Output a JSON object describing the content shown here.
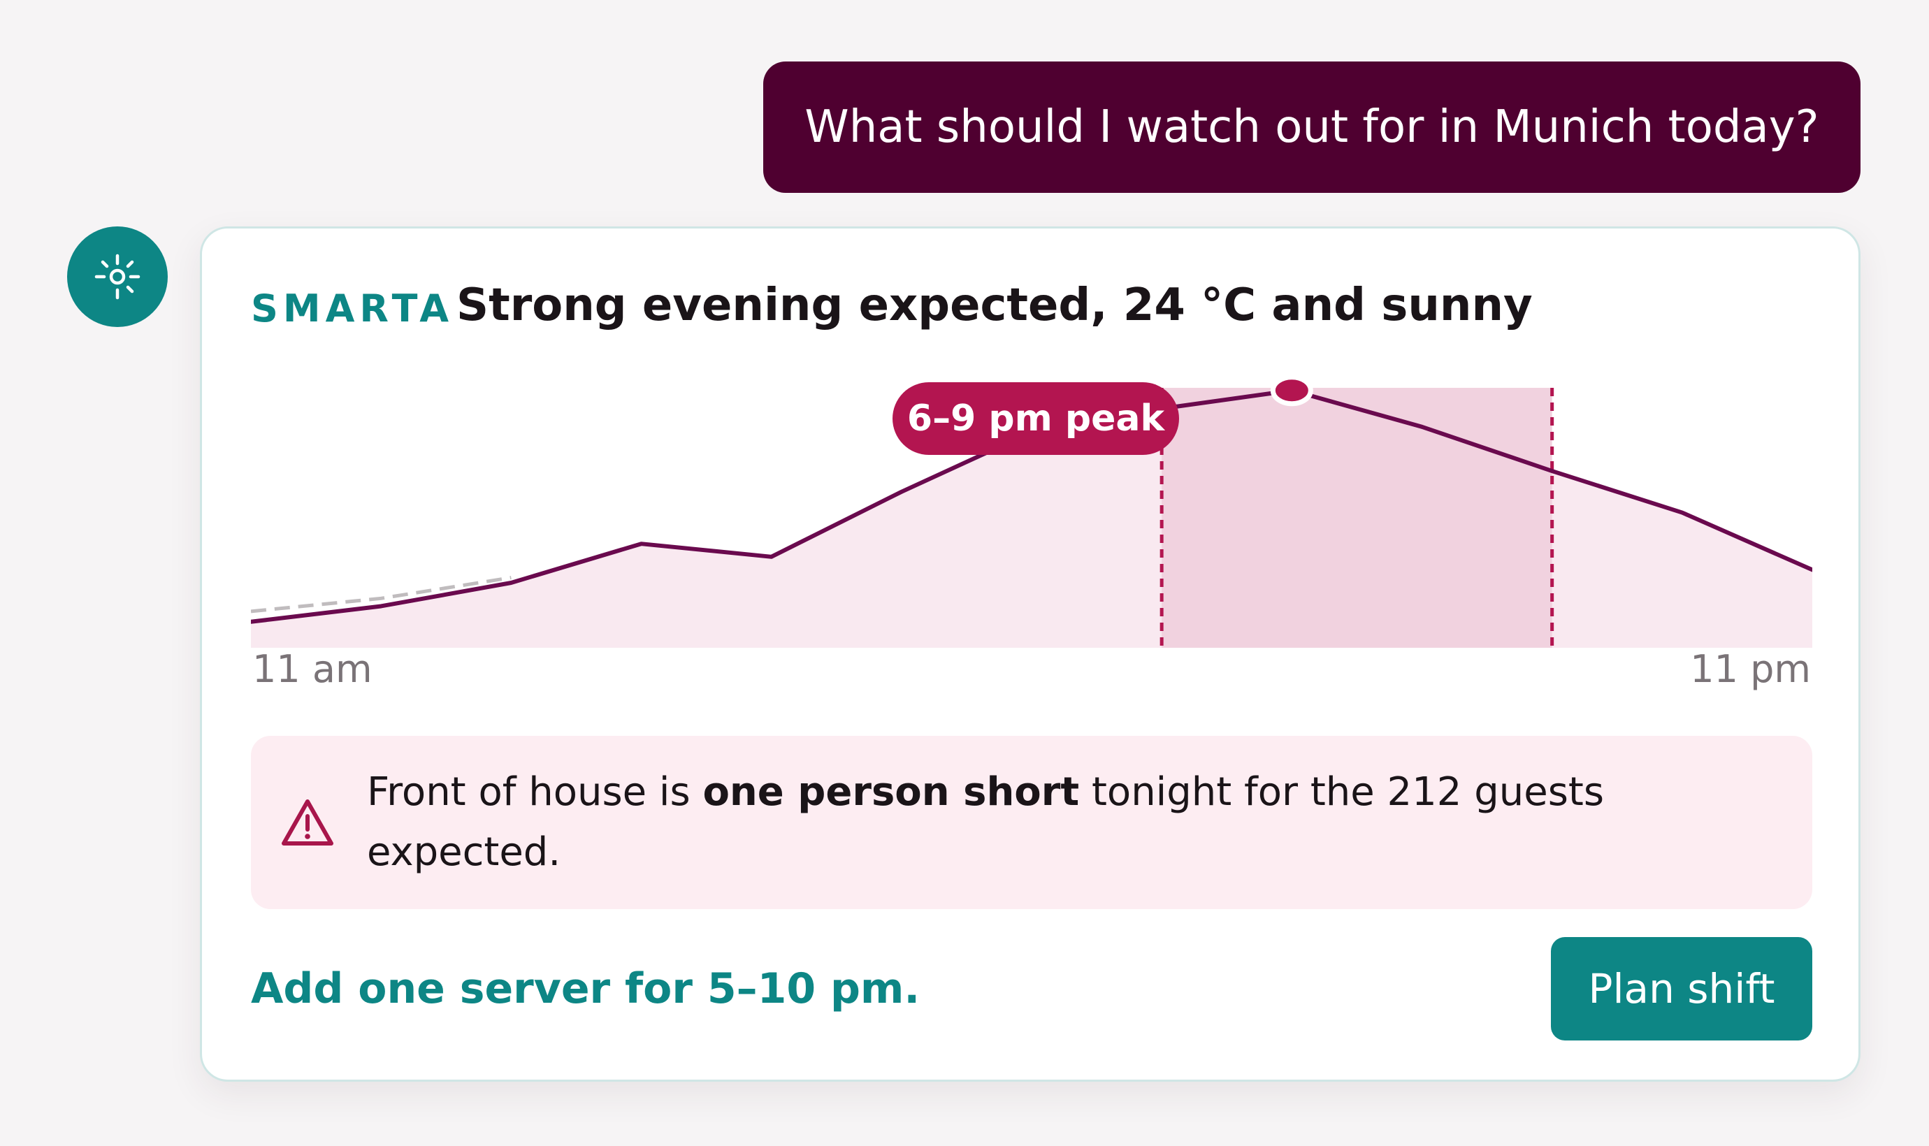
{
  "conversation": {
    "user_message": "What should I watch out for in Munich today?",
    "assistant_icon": "sun-icon"
  },
  "card": {
    "brand": "SMARTA",
    "headline": "Strong evening expected, 24 °C and sunny",
    "peak_label": "6–9 pm peak",
    "alert": {
      "icon": "warning-triangle-icon",
      "text_before": "Front of house is ",
      "text_bold": "one person short",
      "text_after": " tonight for the 212 guests expected."
    },
    "recommendation": "Add one server for 5–10 pm.",
    "plan_button_label": "Plan shift"
  },
  "colors": {
    "brand_teal": "#0d8685",
    "user_bubble": "#4f0030",
    "line": "#6a0a4e",
    "peak_accent": "#b31550",
    "area_fill": "#f9e9f0",
    "peak_band": "#f1d2df",
    "alert_bg": "#fdedf2",
    "baseline": "#c0bcbe"
  },
  "chart_data": {
    "type": "line",
    "x_start_label": "11 am",
    "x_end_label": "11 pm",
    "x_hours": [
      11,
      12,
      13,
      14,
      15,
      16,
      17,
      18,
      19,
      20,
      21,
      22,
      23
    ],
    "series": [
      {
        "values": [
          10,
          16,
          25,
          40,
          35,
          60,
          83,
          92,
          99,
          85,
          68,
          52,
          30
        ]
      }
    ],
    "baseline_values": [
      14,
      19,
      27
    ],
    "peak_window": [
      18,
      21
    ],
    "peak_point_hour": 19,
    "ylim": [
      0,
      100
    ],
    "grid": false
  }
}
